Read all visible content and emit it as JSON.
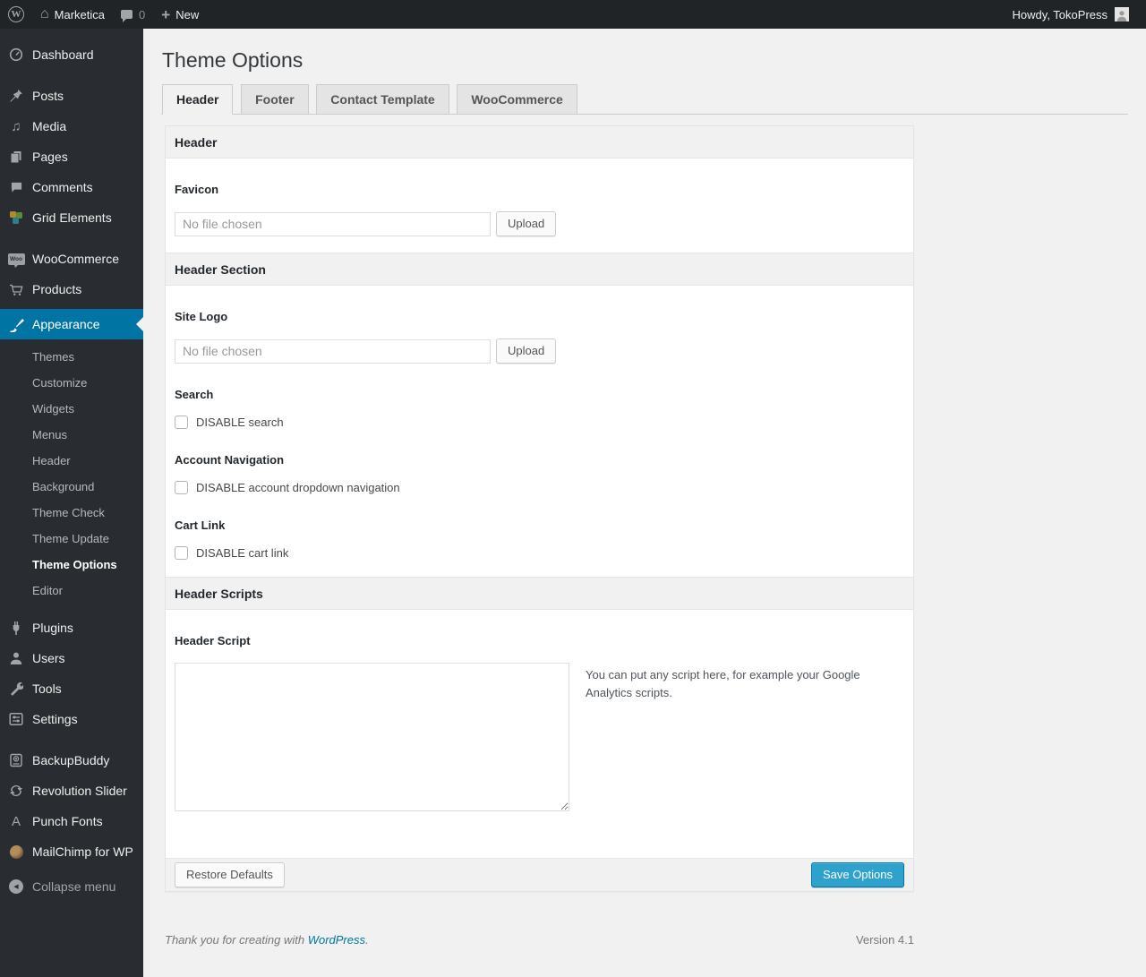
{
  "admin_bar": {
    "site_name": "Marketica",
    "comment_count": "0",
    "new_label": "New",
    "howdy": "Howdy, TokoPress"
  },
  "icons": {
    "wp_logo_letter": "W",
    "home_glyph": "⌂",
    "plus_glyph": "+",
    "media_glyph": "♫",
    "punch_fonts_letter": "A",
    "woo_badge": "Woo",
    "collapse_arrow": "◀"
  },
  "sidebar": {
    "menu": [
      {
        "label": "Dashboard"
      },
      {
        "label": "Posts"
      },
      {
        "label": "Media"
      },
      {
        "label": "Pages"
      },
      {
        "label": "Comments"
      },
      {
        "label": "Grid Elements"
      },
      {
        "label": "WooCommerce"
      },
      {
        "label": "Products"
      },
      {
        "label": "Appearance",
        "current": true
      },
      {
        "label": "Plugins"
      },
      {
        "label": "Users"
      },
      {
        "label": "Tools"
      },
      {
        "label": "Settings"
      },
      {
        "label": "BackupBuddy"
      },
      {
        "label": "Revolution Slider"
      },
      {
        "label": "Punch Fonts"
      },
      {
        "label": "MailChimp for WP"
      },
      {
        "label": "Collapse menu"
      }
    ],
    "appearance_submenu": [
      {
        "label": "Themes"
      },
      {
        "label": "Customize"
      },
      {
        "label": "Widgets"
      },
      {
        "label": "Menus"
      },
      {
        "label": "Header"
      },
      {
        "label": "Background"
      },
      {
        "label": "Theme Check"
      },
      {
        "label": "Theme Update"
      },
      {
        "label": "Theme Options",
        "current": true
      },
      {
        "label": "Editor"
      }
    ]
  },
  "page": {
    "title": "Theme Options",
    "tabs": [
      {
        "label": "Header",
        "active": true
      },
      {
        "label": "Footer",
        "active": false
      },
      {
        "label": "Contact Template",
        "active": false
      },
      {
        "label": "WooCommerce",
        "active": false
      }
    ]
  },
  "panel": {
    "sections": [
      {
        "title": "Header"
      },
      {
        "title": "Header Section"
      },
      {
        "title": "Header Scripts"
      }
    ],
    "favicon": {
      "label": "Favicon",
      "file_value": "No file chosen",
      "upload_label": "Upload"
    },
    "site_logo": {
      "label": "Site Logo",
      "file_value": "No file chosen",
      "upload_label": "Upload"
    },
    "search": {
      "label": "Search",
      "checkbox_label": "DISABLE search",
      "checked": false
    },
    "account_navigation": {
      "label": "Account Navigation",
      "checkbox_label": "DISABLE account dropdown navigation",
      "checked": false
    },
    "cart_link": {
      "label": "Cart Link",
      "checkbox_label": "DISABLE cart link",
      "checked": false
    },
    "header_script": {
      "label": "Header Script",
      "textarea_value": "",
      "description": "You can put any script here, for example your Google Analytics scripts."
    },
    "actions": {
      "restore_label": "Restore Defaults",
      "save_label": "Save Options"
    }
  },
  "page_footer": {
    "thanks_text": "Thank you for creating with ",
    "link_text": "WordPress",
    "period": ".",
    "version": "Version 4.1"
  },
  "colors": {
    "accent_blue": "#0074a2",
    "button_blue": "#2ea2cc",
    "admin_bar_bg": "#212426",
    "menu_bg": "#292d31",
    "page_bg": "#f1f1f1"
  }
}
